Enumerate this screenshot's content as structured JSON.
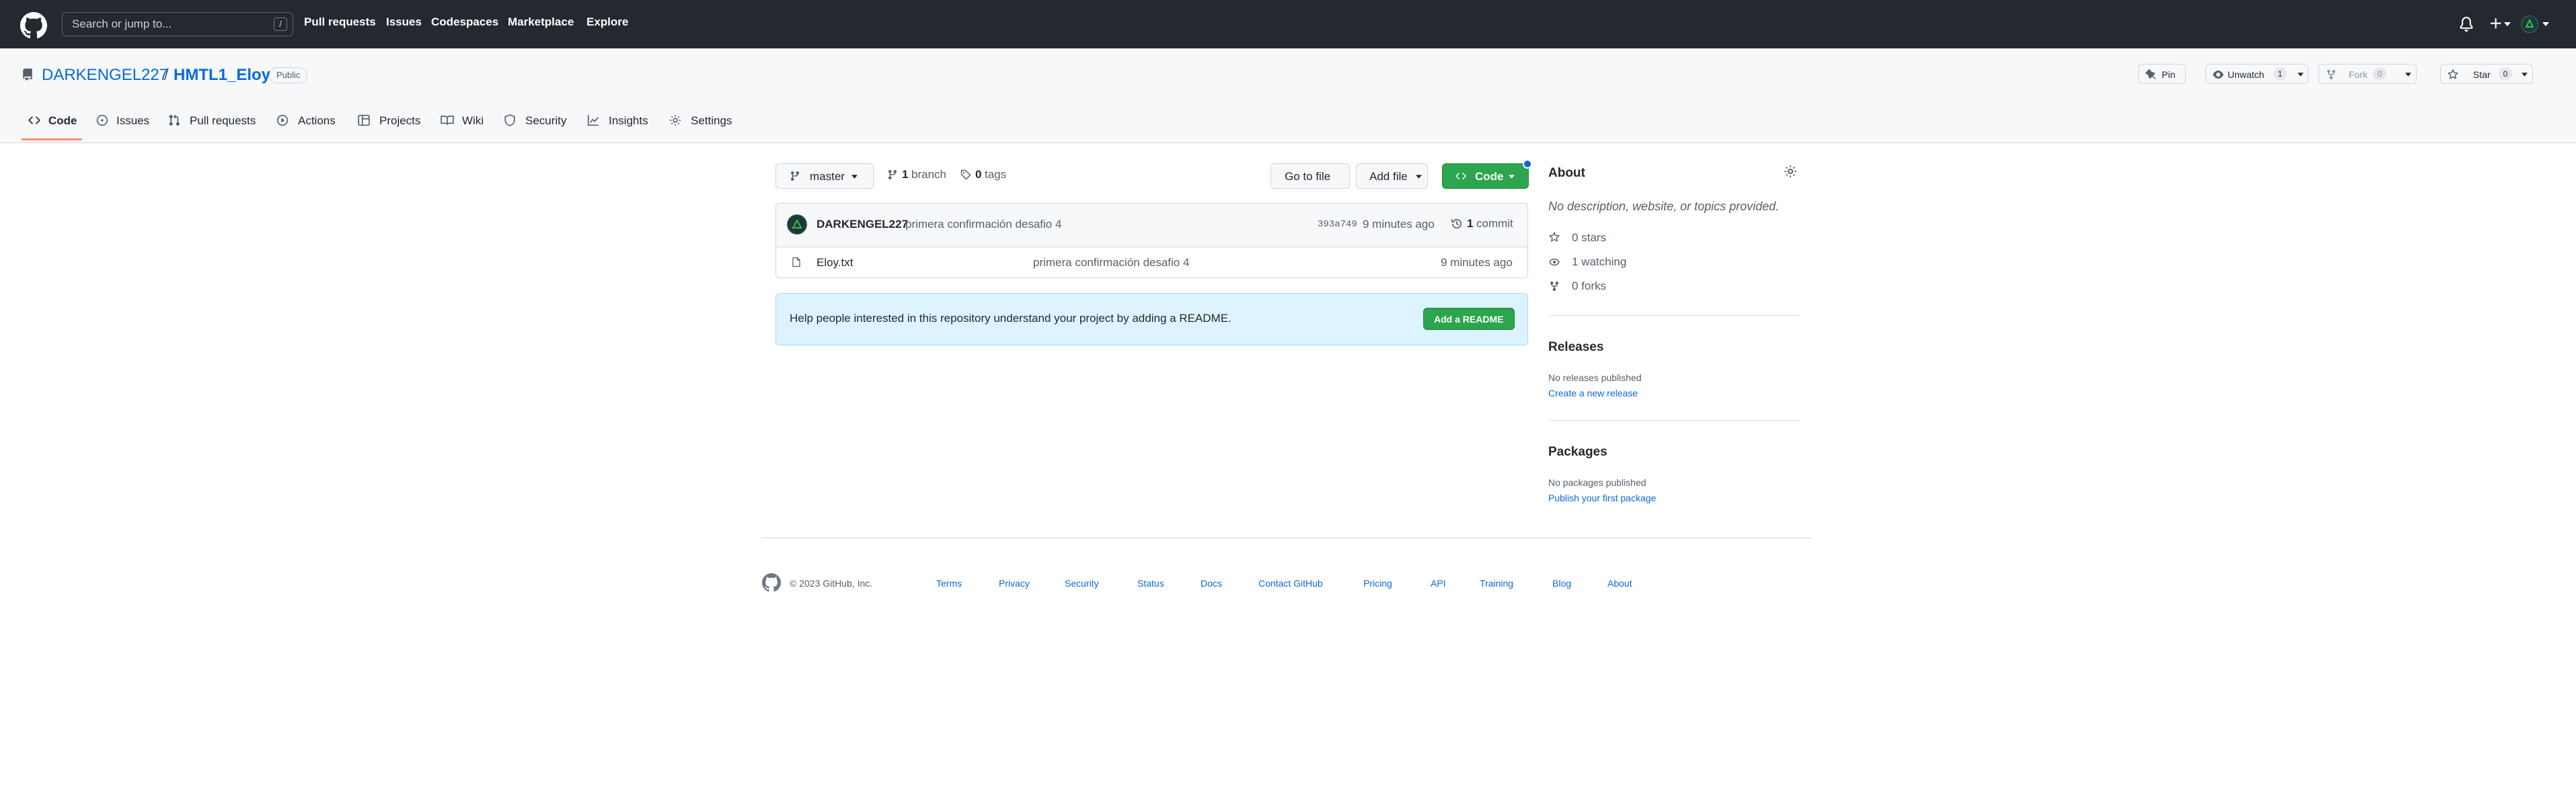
{
  "header": {
    "search_placeholder": "Search or jump to...",
    "search_shortcut": "/",
    "nav": [
      "Pull requests",
      "Issues",
      "Codespaces",
      "Marketplace",
      "Explore"
    ]
  },
  "repo": {
    "owner": "DARKENGEL227",
    "separator": "/",
    "name": "HMTL1_Eloy",
    "visibility": "Public",
    "actions": {
      "pin": "Pin",
      "unwatch": "Unwatch",
      "watch_count": "1",
      "fork": "Fork",
      "fork_count": "0",
      "star": "Star",
      "star_count": "0"
    },
    "tabs": [
      "Code",
      "Issues",
      "Pull requests",
      "Actions",
      "Projects",
      "Wiki",
      "Security",
      "Insights",
      "Settings"
    ]
  },
  "main": {
    "branch": "master",
    "branches_count": "1",
    "branches_label": "branch",
    "tags_count": "0",
    "tags_label": "tags",
    "go_to_file": "Go to file",
    "add_file": "Add file",
    "code": "Code",
    "commit": {
      "author": "DARKENGEL227",
      "message": "primera confirmación desafio 4",
      "sha": "393a749",
      "time": "9 minutes ago",
      "commits_count": "1",
      "commits_label": "commit"
    },
    "files": [
      {
        "name": "Eloy.txt",
        "message": "primera confirmación desafio 4",
        "time": "9 minutes ago"
      }
    ],
    "readme_prompt": "Help people interested in this repository understand your project by adding a README.",
    "add_readme": "Add a README"
  },
  "sidebar": {
    "about_title": "About",
    "about_desc": "No description, website, or topics provided.",
    "stars": "0 stars",
    "watching": "1 watching",
    "forks": "0 forks",
    "releases_title": "Releases",
    "releases_none": "No releases published",
    "releases_link": "Create a new release",
    "packages_title": "Packages",
    "packages_none": "No packages published",
    "packages_link": "Publish your first package"
  },
  "footer": {
    "copyright": "© 2023 GitHub, Inc.",
    "links": [
      "Terms",
      "Privacy",
      "Security",
      "Status",
      "Docs",
      "Contact GitHub",
      "Pricing",
      "API",
      "Training",
      "Blog",
      "About"
    ]
  },
  "colors": {
    "header_bg": "#24292f",
    "link": "#0969da",
    "primary_button": "#2da44e",
    "tab_underline": "#fd8c73",
    "readme_banner": "#ddf4ff"
  }
}
